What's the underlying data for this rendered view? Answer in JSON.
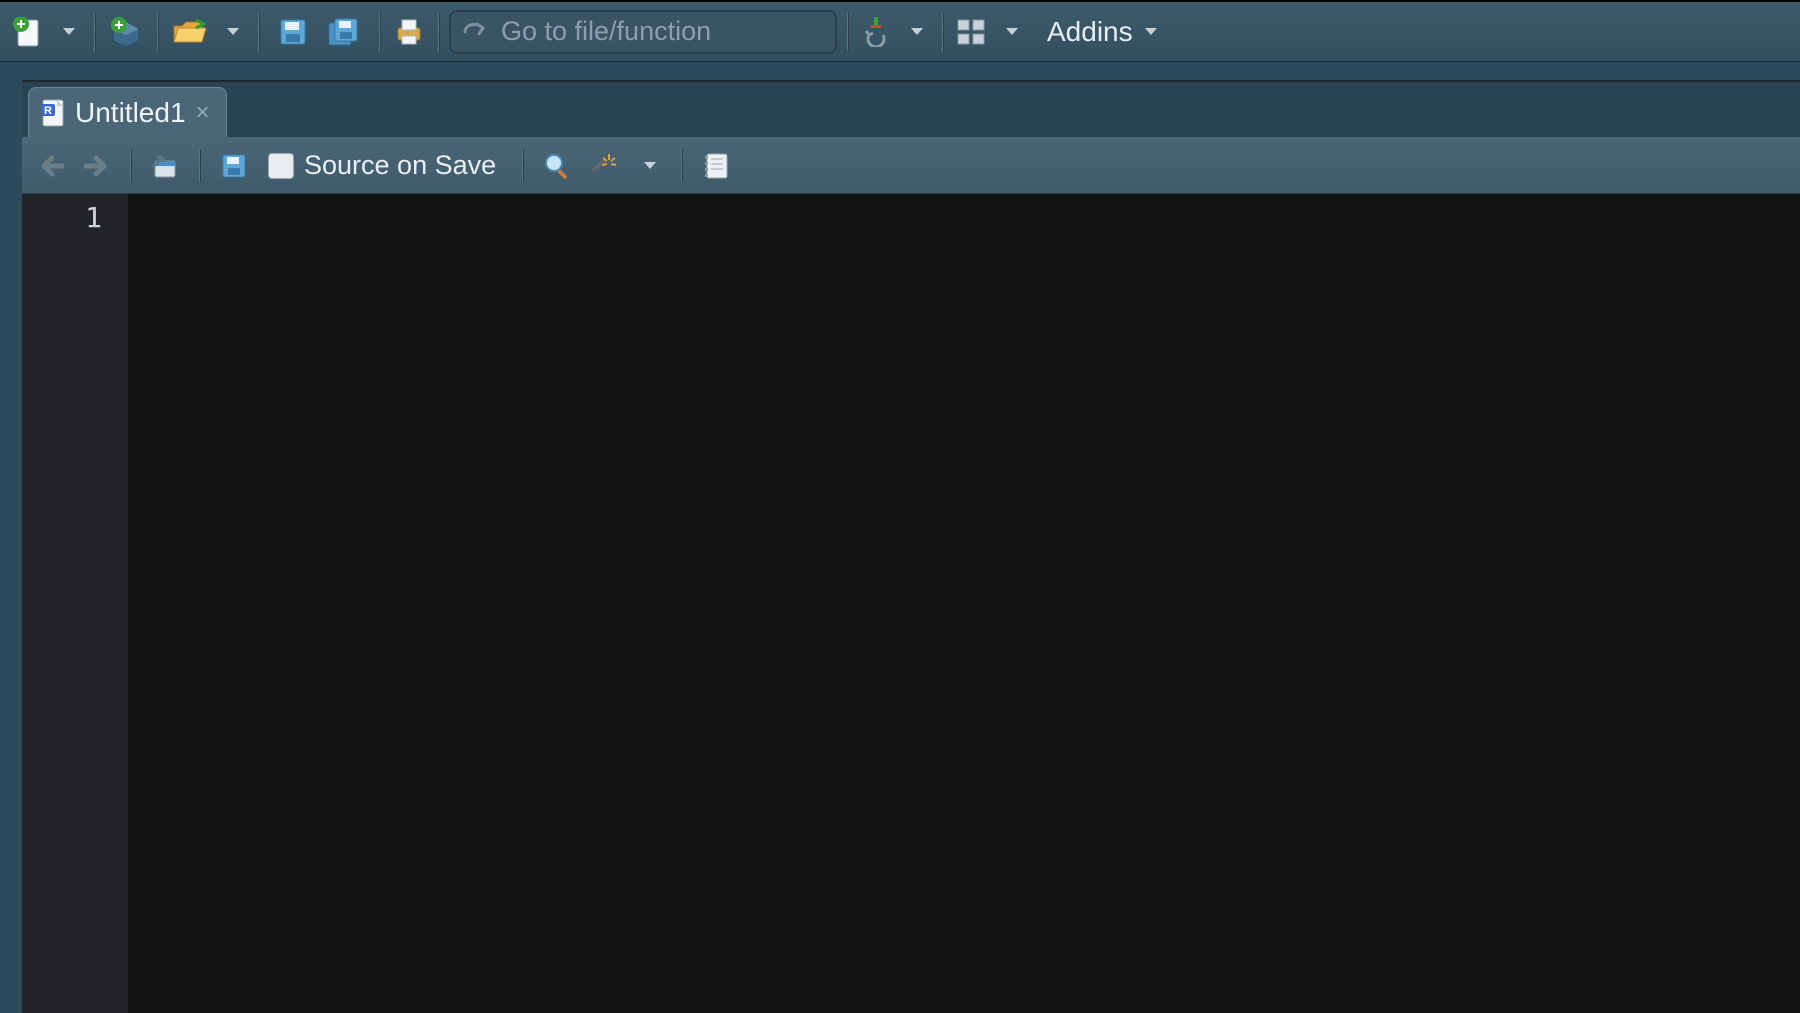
{
  "toolbar": {
    "search_placeholder": "Go to file/function",
    "addins_label": "Addins"
  },
  "tab": {
    "title": "Untitled1"
  },
  "editor_toolbar": {
    "source_on_save_label": "Source on Save"
  },
  "editor": {
    "line_numbers": [
      "1"
    ]
  }
}
